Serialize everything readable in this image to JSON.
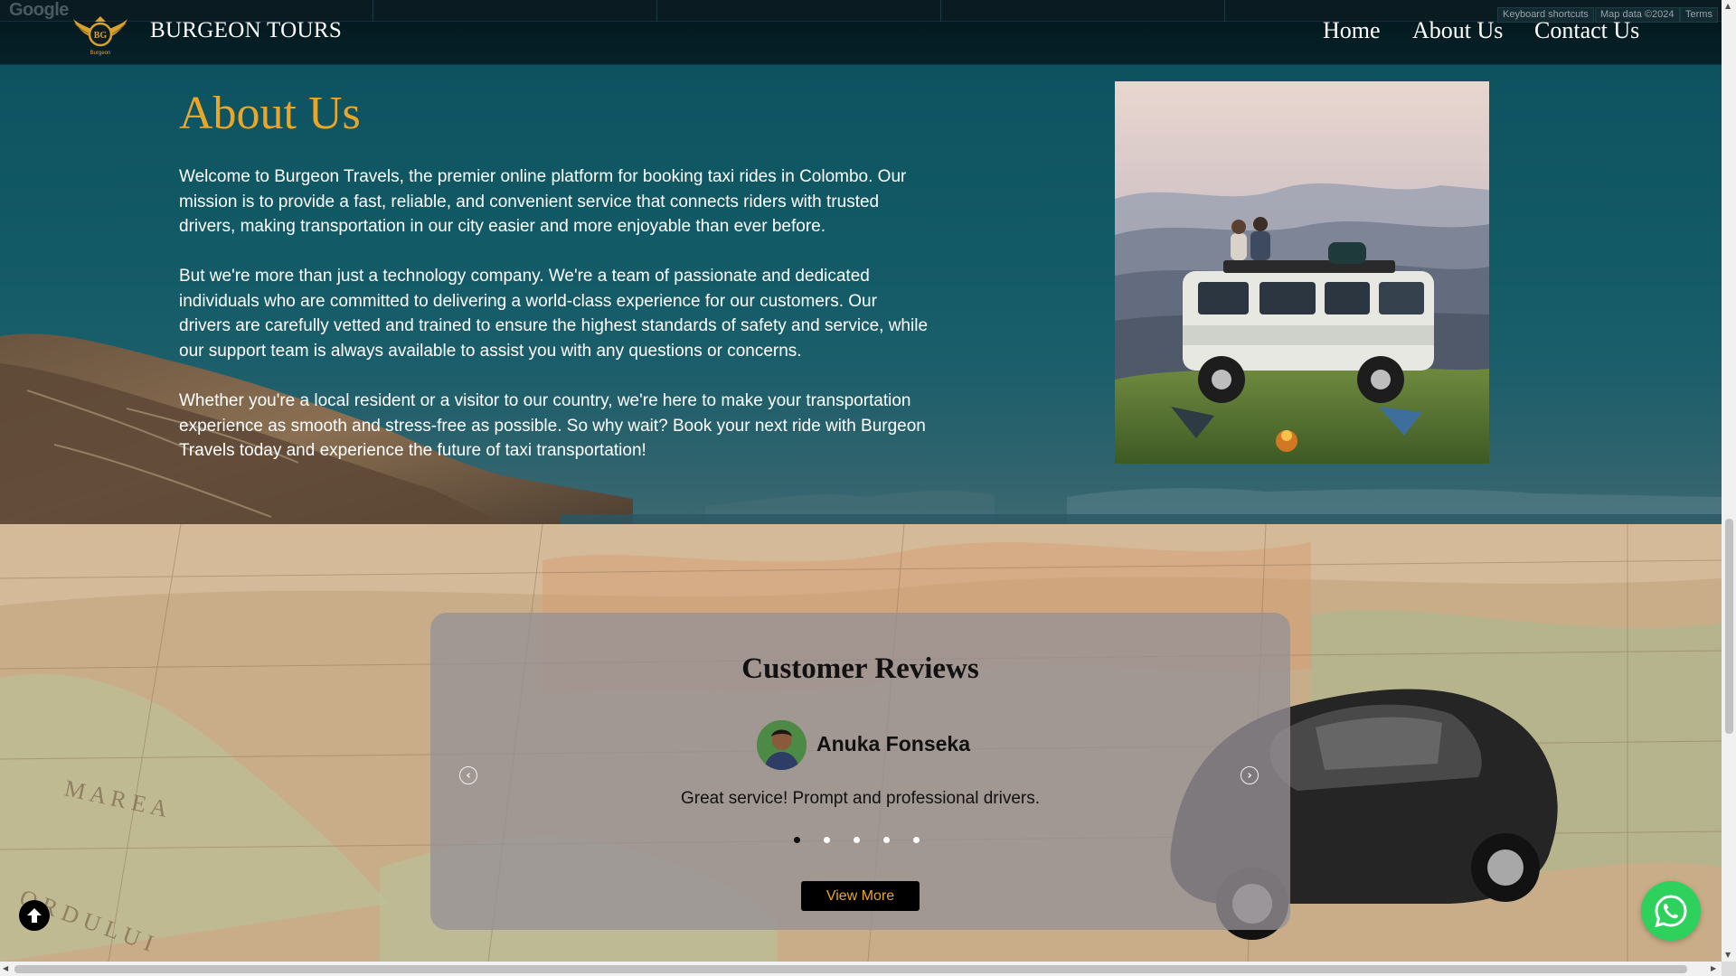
{
  "map_strip": {
    "google_logo": "Google",
    "attribution": [
      "Keyboard shortcuts",
      "Map data ©2024",
      "Terms"
    ]
  },
  "navbar": {
    "logo_text": "BG",
    "logo_subtext": "Burgeon",
    "brand": "BURGEON TOURS",
    "links": [
      "Home",
      "About Us",
      "Contact Us"
    ]
  },
  "about": {
    "title": "About Us",
    "paragraphs": [
      "Welcome to Burgeon Travels, the premier online platform for booking taxi rides in Colombo. Our mission is to provide a fast, reliable, and convenient service that connects riders with trusted drivers, making transportation in our city easier and more enjoyable than ever before.",
      "But we're more than just a technology company. We're a team of passionate and dedicated individuals who are committed to delivering a world-class experience for our customers. Our drivers are carefully vetted and trained to ensure the highest standards of safety and service, while our support team is always available to assist you with any questions or concerns.",
      "Whether you're a local resident or a visitor to our country, we're here to make your transportation experience as smooth and stress-free as possible. So why wait? Book your next ride with Burgeon Travels today and experience the future of taxi transportation!"
    ]
  },
  "reviews": {
    "title": "Customer Reviews",
    "current": {
      "name": "Anuka Fonseka",
      "text": "Great service! Prompt and professional drivers."
    },
    "dot_count": 5,
    "active_dot": 0,
    "button_label": "View More"
  },
  "icons": {
    "prev": "chevron-left-icon",
    "next": "chevron-right-icon",
    "scroll_top": "arrow-up-icon",
    "whatsapp": "whatsapp-icon"
  },
  "colors": {
    "accent": "#e9a629",
    "navbar": "#03161c",
    "whatsapp": "#2fd15d"
  }
}
